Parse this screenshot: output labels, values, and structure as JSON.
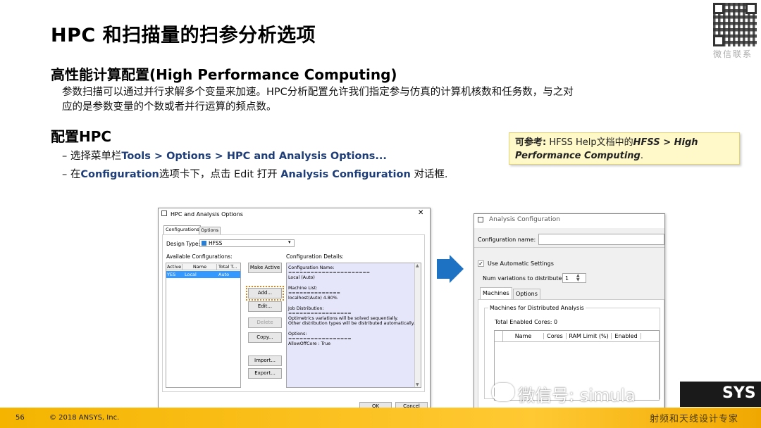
{
  "slide": {
    "title": "HPC 和扫描量的扫参分析选项",
    "section1_heading": "高性能计算配置(High Performance Computing)",
    "section1_para_line1": "参数扫描可以通过并行求解多个变量来加速。HPC分析配置允许我们指定参与仿真的计算机核数和任务数，与之对",
    "section1_para_line2": "应的是参数变量的个数或者并行运算的频点数。",
    "section2_heading": "配置HPC",
    "bullet1_prefix": "– 选择菜单栏",
    "bullet1_path": "Tools  > Options  > HPC and Analysis Options...",
    "bullet2_prefix": "– 在",
    "bullet2_tab": "Configuration",
    "bullet2_mid": "选项卡下，点击  Edit 打开 ",
    "bullet2_dialog": "Analysis Configuration",
    "bullet2_suffix": " 对话框.",
    "ref_label": "可参考:",
    "ref_text": " HFSS Help文档中的",
    "ref_path_line1": "HFSS > High",
    "ref_path_line2": "Performance Computing",
    "ref_end": ".",
    "qr_label": "微信联系",
    "page_number": "56",
    "copyright": "© 2018 ANSYS, Inc.",
    "watermark": "微信号: simula",
    "watermark_brand_suffix": "SYS",
    "watermark_sub": "射频和天线设计专家",
    "colors": {
      "footer": "#f4b400",
      "accent_blue": "#1f3e78",
      "arrow": "#1e72c4"
    }
  },
  "hpc_dialog": {
    "title": "HPC and Analysis Options",
    "close": "✕",
    "tabs": [
      "Configurations",
      "Options"
    ],
    "design_type_label": "Design Type:",
    "design_type_value": "HFSS",
    "available_label": "Available Configurations:",
    "details_label": "Configuration Details:",
    "table_headers": [
      "Active",
      "Name",
      "Total T..."
    ],
    "table_rows": [
      [
        "YES",
        "Local",
        "Auto"
      ]
    ],
    "buttons": {
      "make_active": "Make Active",
      "add": "Add...",
      "edit": "Edit...",
      "delete": "Delete",
      "copy": "Copy...",
      "import": "Import...",
      "export": "Export...",
      "ok": "OK",
      "cancel": "Cancel"
    },
    "details_lines": [
      "Configuration Name:",
      "======================",
      "Local (Auto)",
      "",
      "Machine List:",
      "==============",
      "localhost(Auto) 4.80%",
      "",
      "Job Distribution:",
      "=================",
      "Optimetrics variations will be solved sequentially.",
      "Other distribution types will be distributed automatically.",
      "",
      "Options:",
      "=================",
      "AllowOffCore : True"
    ]
  },
  "analysis_dialog": {
    "title": "Analysis Configuration",
    "config_name_label": "Configuration name:",
    "config_name_value": "",
    "use_auto_label": "Use Automatic Settings",
    "use_auto_checked": true,
    "num_variations_label": "Num variations to distribute:",
    "num_variations_value": "1",
    "tabs": [
      "Machines",
      "Options"
    ],
    "group_label": "Machines for Distributed Analysis",
    "total_cores_label": "Total Enabled Cores: 0",
    "table_headers": [
      "Name",
      "Cores",
      "RAM Limit (%)",
      "Enabled"
    ]
  }
}
